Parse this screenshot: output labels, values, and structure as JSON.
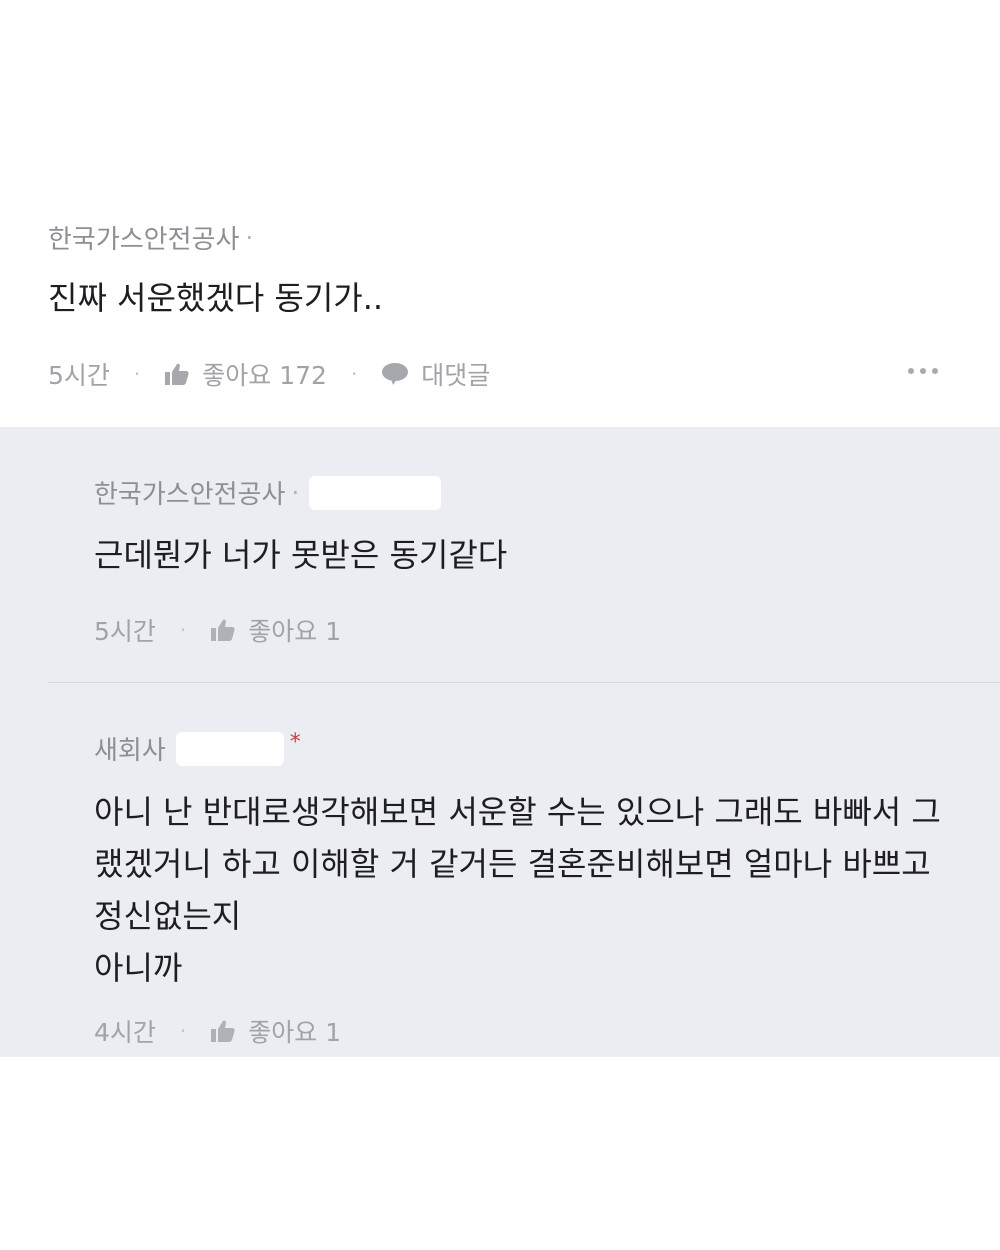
{
  "comment": {
    "author": "한국가스안전공사",
    "separator": "·",
    "text": "진짜 서운했겠다 동기가..",
    "time": "5시간",
    "like_label": "좋아요 172",
    "reply_label": "대댓글",
    "action_sep": "·"
  },
  "replies": [
    {
      "author": "한국가스안전공사",
      "separator": "·",
      "text": "근데뭔가 너가 못받은 동기같다",
      "time": "5시간",
      "like_label": "좋아요 1",
      "action_sep": "·"
    },
    {
      "author": "새회사",
      "badge": "*",
      "text_lines": [
        "아니 난 반대로생각해보면 서운할 수는 있으나 그래도 바빠서 그",
        "랬겠거니 하고 이해할 거 같거든 결혼준비해보면 얼마나 바쁘고",
        "정신없는지",
        "아니까"
      ],
      "time": "4시간",
      "like_label": "좋아요 1",
      "action_sep": "·"
    }
  ],
  "icons": {
    "like": "thumbs-up-icon",
    "reply": "speech-bubble-icon",
    "more": "more-dots-icon"
  }
}
